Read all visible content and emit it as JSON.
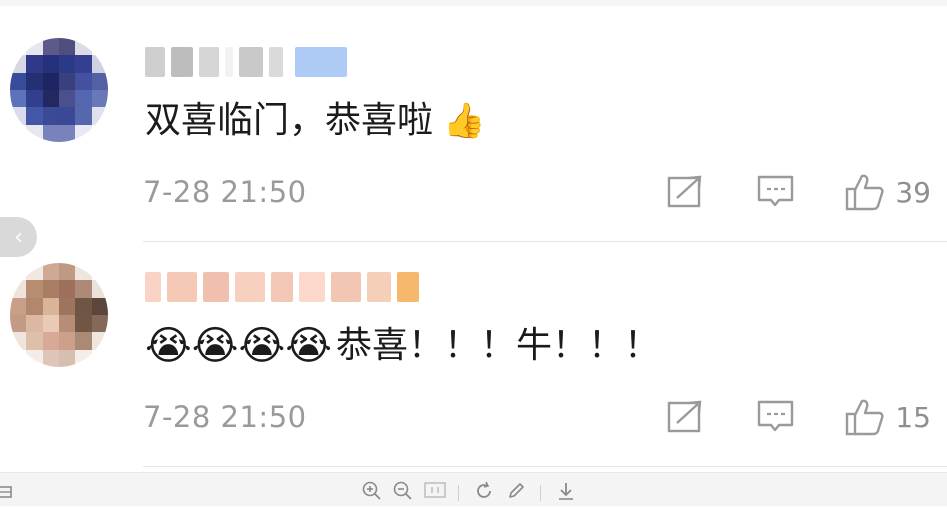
{
  "comments": [
    {
      "content": "双喜临门，恭喜啦",
      "emoji_suffix": "👍",
      "timestamp": "7-28 21:50",
      "like_count": "39",
      "icons": [
        "share-icon",
        "comment-icon",
        "like-icon"
      ]
    },
    {
      "emoji_prefix": "😭😭😭😭",
      "content": "恭喜！！！牛！！！",
      "timestamp": "7-28 21:50",
      "like_count": "15",
      "icons": [
        "share-icon",
        "comment-icon",
        "like-icon"
      ]
    }
  ],
  "back_button": {
    "icon": "chevron-left-icon",
    "glyph": "‹"
  },
  "viewer_toolbar": {
    "tools": [
      "save-icon",
      "zoom-in-icon",
      "zoom-out-icon",
      "fit-icon",
      "rotate-icon",
      "edit-icon",
      "download-icon"
    ]
  },
  "colors": {
    "text": "#1b1b1b",
    "muted": "#9a9a9a",
    "divider": "#e6e6e6"
  }
}
